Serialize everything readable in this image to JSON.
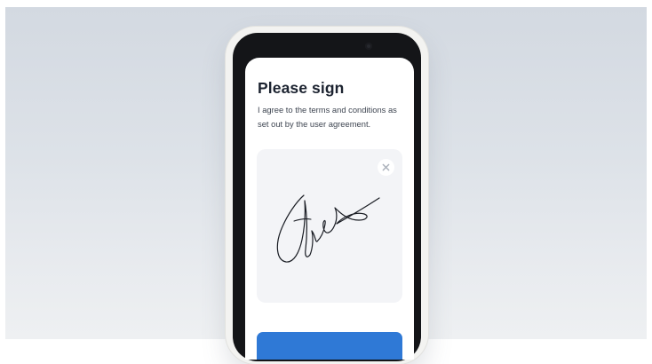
{
  "signing_screen": {
    "title": "Please sign",
    "description": "I agree to the terms and conditions as set out by the user agreement.",
    "clear_icon": "close-icon"
  },
  "colors": {
    "primary_button": "#2f79d6",
    "title_text": "#1c2330",
    "pad_background": "#f3f4f7",
    "signature_ink": "#1a1d24"
  }
}
